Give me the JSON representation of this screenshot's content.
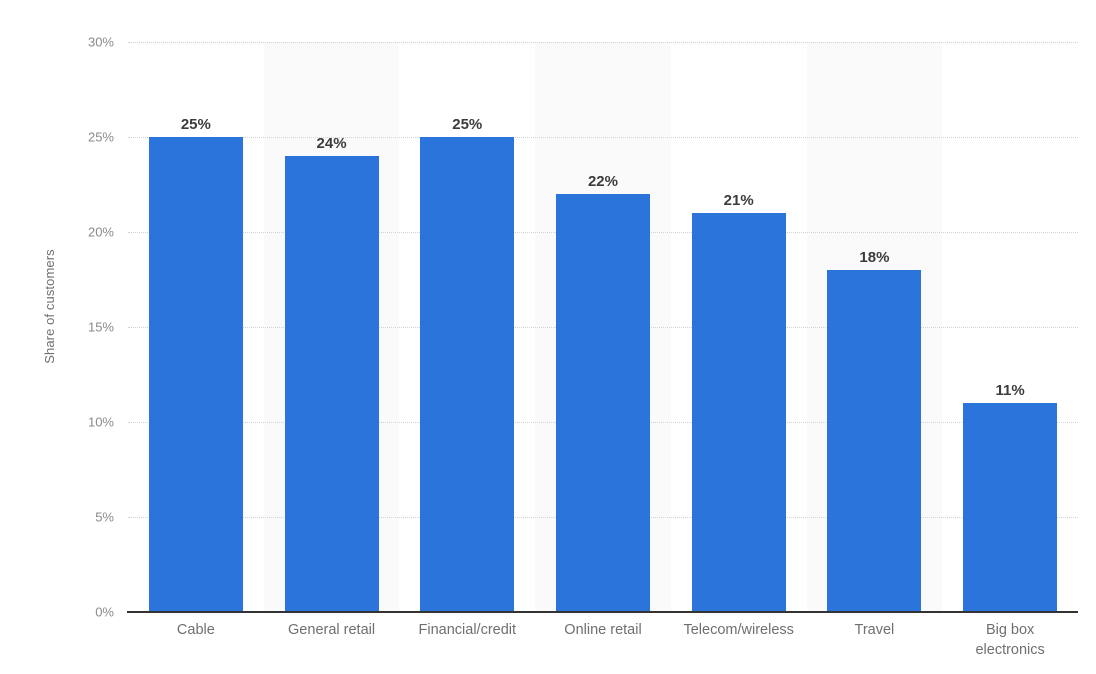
{
  "chart_data": {
    "type": "bar",
    "title": "",
    "subtitle": "",
    "xlabel": "",
    "ylabel": "Share of customers",
    "categories": [
      "Cable",
      "General retail",
      "Financial/credit",
      "Online retail",
      "Telecom/wireless",
      "Travel",
      "Big box electronics"
    ],
    "category_lines": [
      [
        "Cable"
      ],
      [
        "General retail"
      ],
      [
        "Financial/credit"
      ],
      [
        "Online retail"
      ],
      [
        "Telecom/wireless"
      ],
      [
        "Travel"
      ],
      [
        "Big box",
        "electronics"
      ]
    ],
    "values": [
      25,
      24,
      25,
      22,
      21,
      18,
      11
    ],
    "value_labels": [
      "25%",
      "24%",
      "25%",
      "22%",
      "21%",
      "18%",
      "11%"
    ],
    "ylim": [
      0,
      30
    ],
    "yticks": [
      0,
      5,
      10,
      15,
      20,
      25,
      30
    ],
    "ytick_labels": [
      "0%",
      "5%",
      "10%",
      "15%",
      "20%",
      "25%",
      "30%"
    ],
    "grid": true,
    "legend": false,
    "bar_color": "#2a74dc",
    "grid_color": "#d2d2d2",
    "band_color": "#fafafa",
    "axis_color": "#333333",
    "tick_label_color": "#8a8a8a",
    "value_label_color": "#3c3c3c",
    "category_label_color": "#6f6f6f"
  }
}
